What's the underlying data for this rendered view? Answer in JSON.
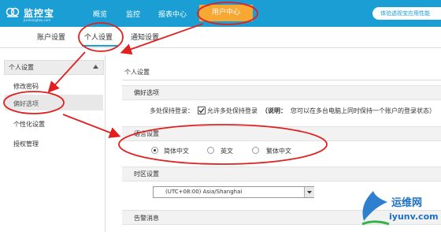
{
  "app": {
    "name": "监控宝",
    "sub": "Jiankongbao.com"
  },
  "nav": {
    "items": [
      "概览",
      "监控",
      "报表中心"
    ],
    "active": "用户中心",
    "trial": "体验透视宝应用性能"
  },
  "subnav": {
    "items": [
      "账户设置",
      "个人设置",
      "通知设置"
    ]
  },
  "sidebar": {
    "header": "个人设置",
    "items": [
      "修改密码",
      "偏好选项",
      "个性化设置",
      "授权管理"
    ]
  },
  "main": {
    "title": "个人设置",
    "pref_section": "偏好选项",
    "keep_login_label": "多处保持登录：",
    "keep_login_checkbox": "允许多处保持登录",
    "keep_login_hint_bold": "（说明：",
    "keep_login_hint": "您可以在多台电脑上同时保持一个账户的登录状态）",
    "lang_section": "语言设置",
    "languages": [
      "简体中文",
      "英文",
      "繁体中文"
    ],
    "selected_language": "简体中文",
    "tz_section": "时区设置",
    "timezone": "(UTC+08:00) Asia/Shanghai",
    "alert_section": "告警消息"
  },
  "watermark": {
    "line1": "运维网",
    "line2": "iyunv.com"
  },
  "colors": {
    "topbar": "#1a9ed4",
    "active_tab": "#f7a832",
    "annotation": "#e02020"
  }
}
